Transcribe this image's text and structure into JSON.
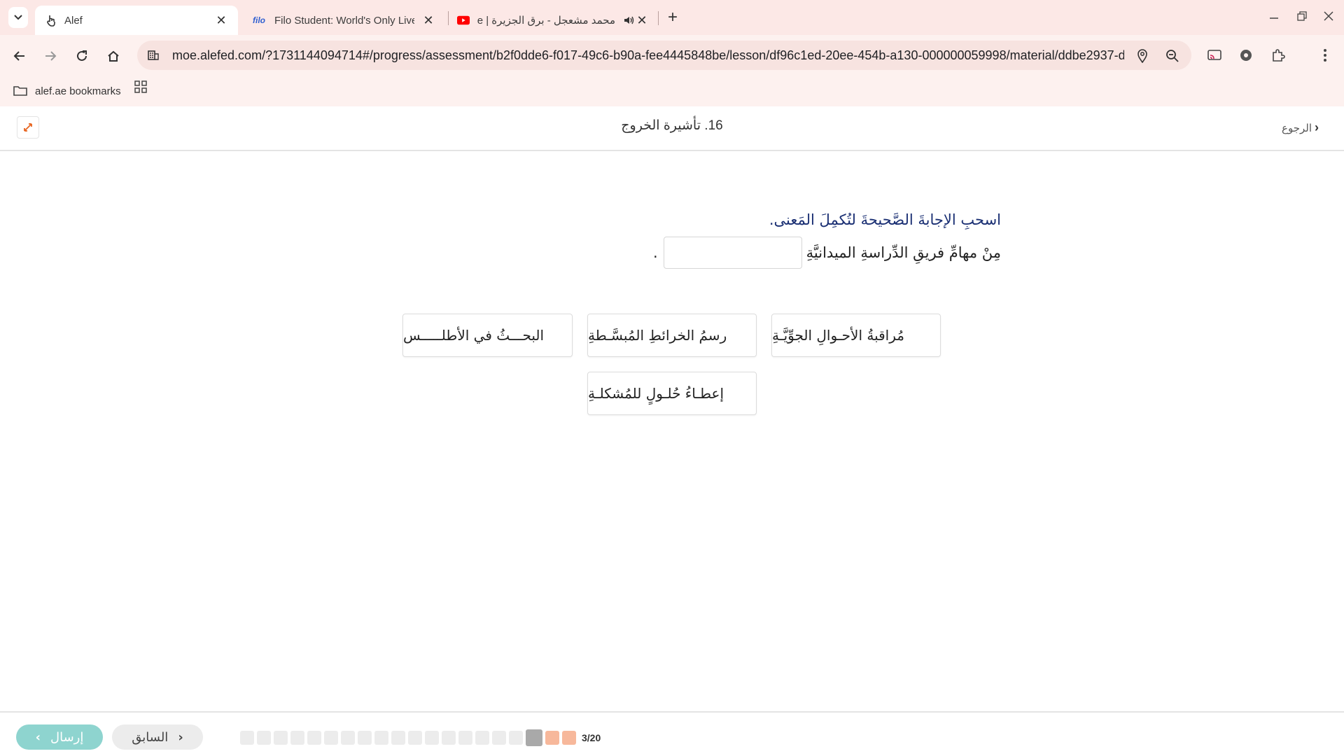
{
  "browser": {
    "tabs": [
      {
        "title": "Alef",
        "icon": "touch-icon"
      },
      {
        "title": "Filo Student: World's Only Live I",
        "icon_text": "filo"
      },
      {
        "title": "محمد مشعجل - برق الجزيرة | e",
        "icon": "youtube-icon"
      }
    ],
    "url": "moe.alefed.com/?1731144094714#/progress/assessment/b2f0dde6-f017-49c6-b90a-fee4445848be/lesson/df96c1ed-20ee-454b-a130-000000059998/material/ddbe2937-d...",
    "bookmark_label": "alef.ae bookmarks",
    "colors": {
      "tabstrip": "#fce8e6",
      "youtube": "#ff0000",
      "filo": "#2f5fd0"
    }
  },
  "header": {
    "title": "16. تأشيرة الخروج",
    "back_label": "الرجوع"
  },
  "question": {
    "instruction": "اسحبِ الإجابةَ الصَّحيحةَ لتُكمِلَ المَعنى.",
    "sentence_before": "مِنْ مهامِّ فريقِ الدِّراسةِ الميدانيَّةِ",
    "sentence_after": "."
  },
  "options": [
    "مُراقبةُ الأحـوالِ الجوِّيَّـةِ",
    "رسمُ الخرائطِ المُبسَّـطةِ",
    "البحـــثُ في الأطلـــــس",
    "إعطـاءُ حُلـولٍ للمُشكلـةِ"
  ],
  "footer": {
    "submit_label": "إرسال",
    "prev_label": "السابق",
    "progress_text": "3/20",
    "progress_current": 3,
    "progress_total": 20,
    "colors": {
      "submit": "#8ed4cf",
      "done": "#f7b89b",
      "current": "#a9a9a9"
    }
  }
}
